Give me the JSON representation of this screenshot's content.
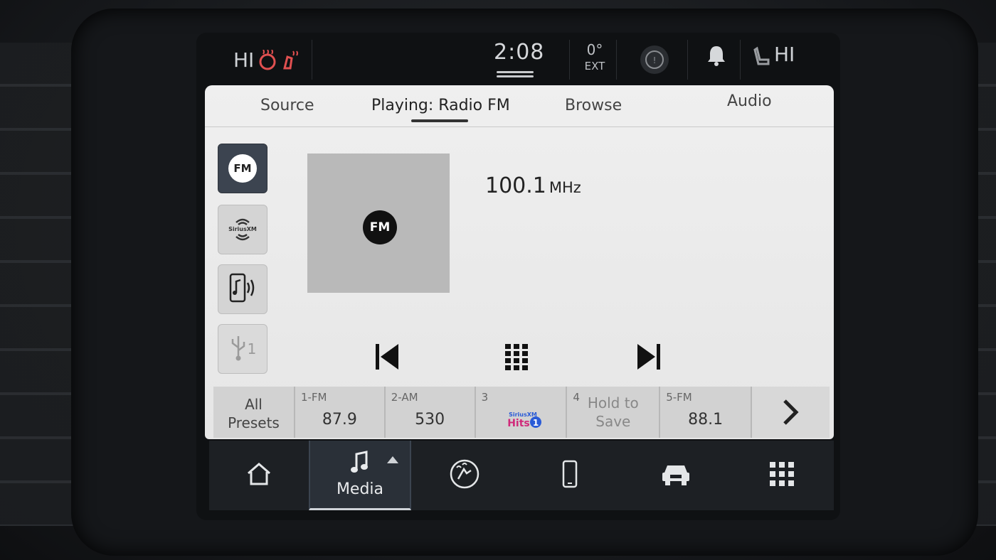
{
  "status_bar": {
    "left_temp_label": "HI",
    "time": "2:08",
    "outside_temp": "0°",
    "outside_temp_unit": "EXT",
    "right_temp_label": "HI",
    "icons": [
      "heated-seat-icon",
      "heated-steering-icon",
      "driver-assist-icon",
      "bell-icon",
      "heated-seat-right-icon"
    ]
  },
  "tabs": {
    "source": "Source",
    "playing": "Playing: Radio FM",
    "browse": "Browse",
    "audio": "Audio"
  },
  "sources": [
    {
      "name": "fm",
      "label": "FM",
      "active": true
    },
    {
      "name": "siriusxm",
      "label": "SiriusXM",
      "active": false
    },
    {
      "name": "bluetooth",
      "label": "",
      "active": false
    },
    {
      "name": "usb",
      "label": "1",
      "active": false
    }
  ],
  "now_playing": {
    "art_label": "FM",
    "frequency": "100.1",
    "unit": "MHz"
  },
  "presets": {
    "all_label_1": "All",
    "all_label_2": "Presets",
    "items": [
      {
        "num": "1-FM",
        "value": "87.9"
      },
      {
        "num": "2-AM",
        "value": "530"
      },
      {
        "num": "3",
        "value": "Hits 1"
      },
      {
        "num": "4",
        "value_1": "Hold to",
        "value_2": "Save"
      },
      {
        "num": "5-FM",
        "value": "88.1"
      }
    ],
    "next_icon": "chevron-right-icon"
  },
  "nav": {
    "media_label": "Media"
  },
  "colors": {
    "panel_bg": "#ececec",
    "active_source": "#3c4450",
    "nav_bg": "#1d2024"
  }
}
